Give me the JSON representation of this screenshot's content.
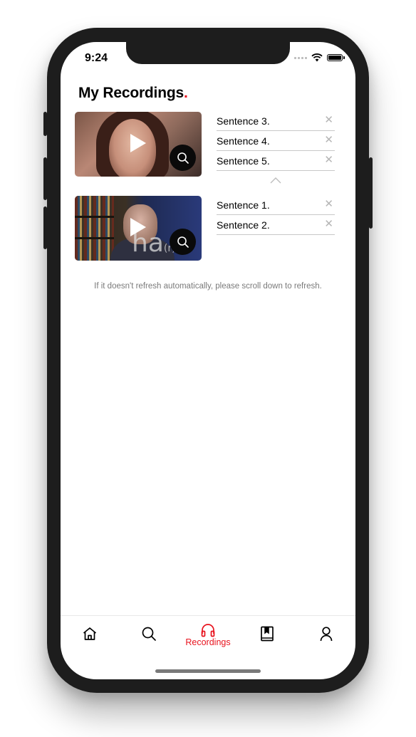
{
  "status_bar": {
    "time": "9:24"
  },
  "page": {
    "title": "My Recordings",
    "title_dot": "."
  },
  "recordings": [
    {
      "sentences": [
        "Sentence 3.",
        "Sentence 4.",
        "Sentence 5."
      ]
    },
    {
      "sentences": [
        "Sentence 1.",
        "Sentence 2."
      ],
      "overlay_text": "ha",
      "overlay_sub": "(r)"
    }
  ],
  "remove_glyph": "✕",
  "hint": "If it doesn't refresh automatically, please scroll down to refresh.",
  "tabs": [
    {
      "icon": "home-icon",
      "label": ""
    },
    {
      "icon": "search-icon",
      "label": ""
    },
    {
      "icon": "headphones-icon",
      "label": "Recordings",
      "active": true
    },
    {
      "icon": "bookmark-book-icon",
      "label": ""
    },
    {
      "icon": "person-icon",
      "label": ""
    }
  ],
  "colors": {
    "accent": "#e8131e",
    "text": "#000000",
    "hint": "#7a7a7a",
    "divider": "#c8c8c8"
  }
}
